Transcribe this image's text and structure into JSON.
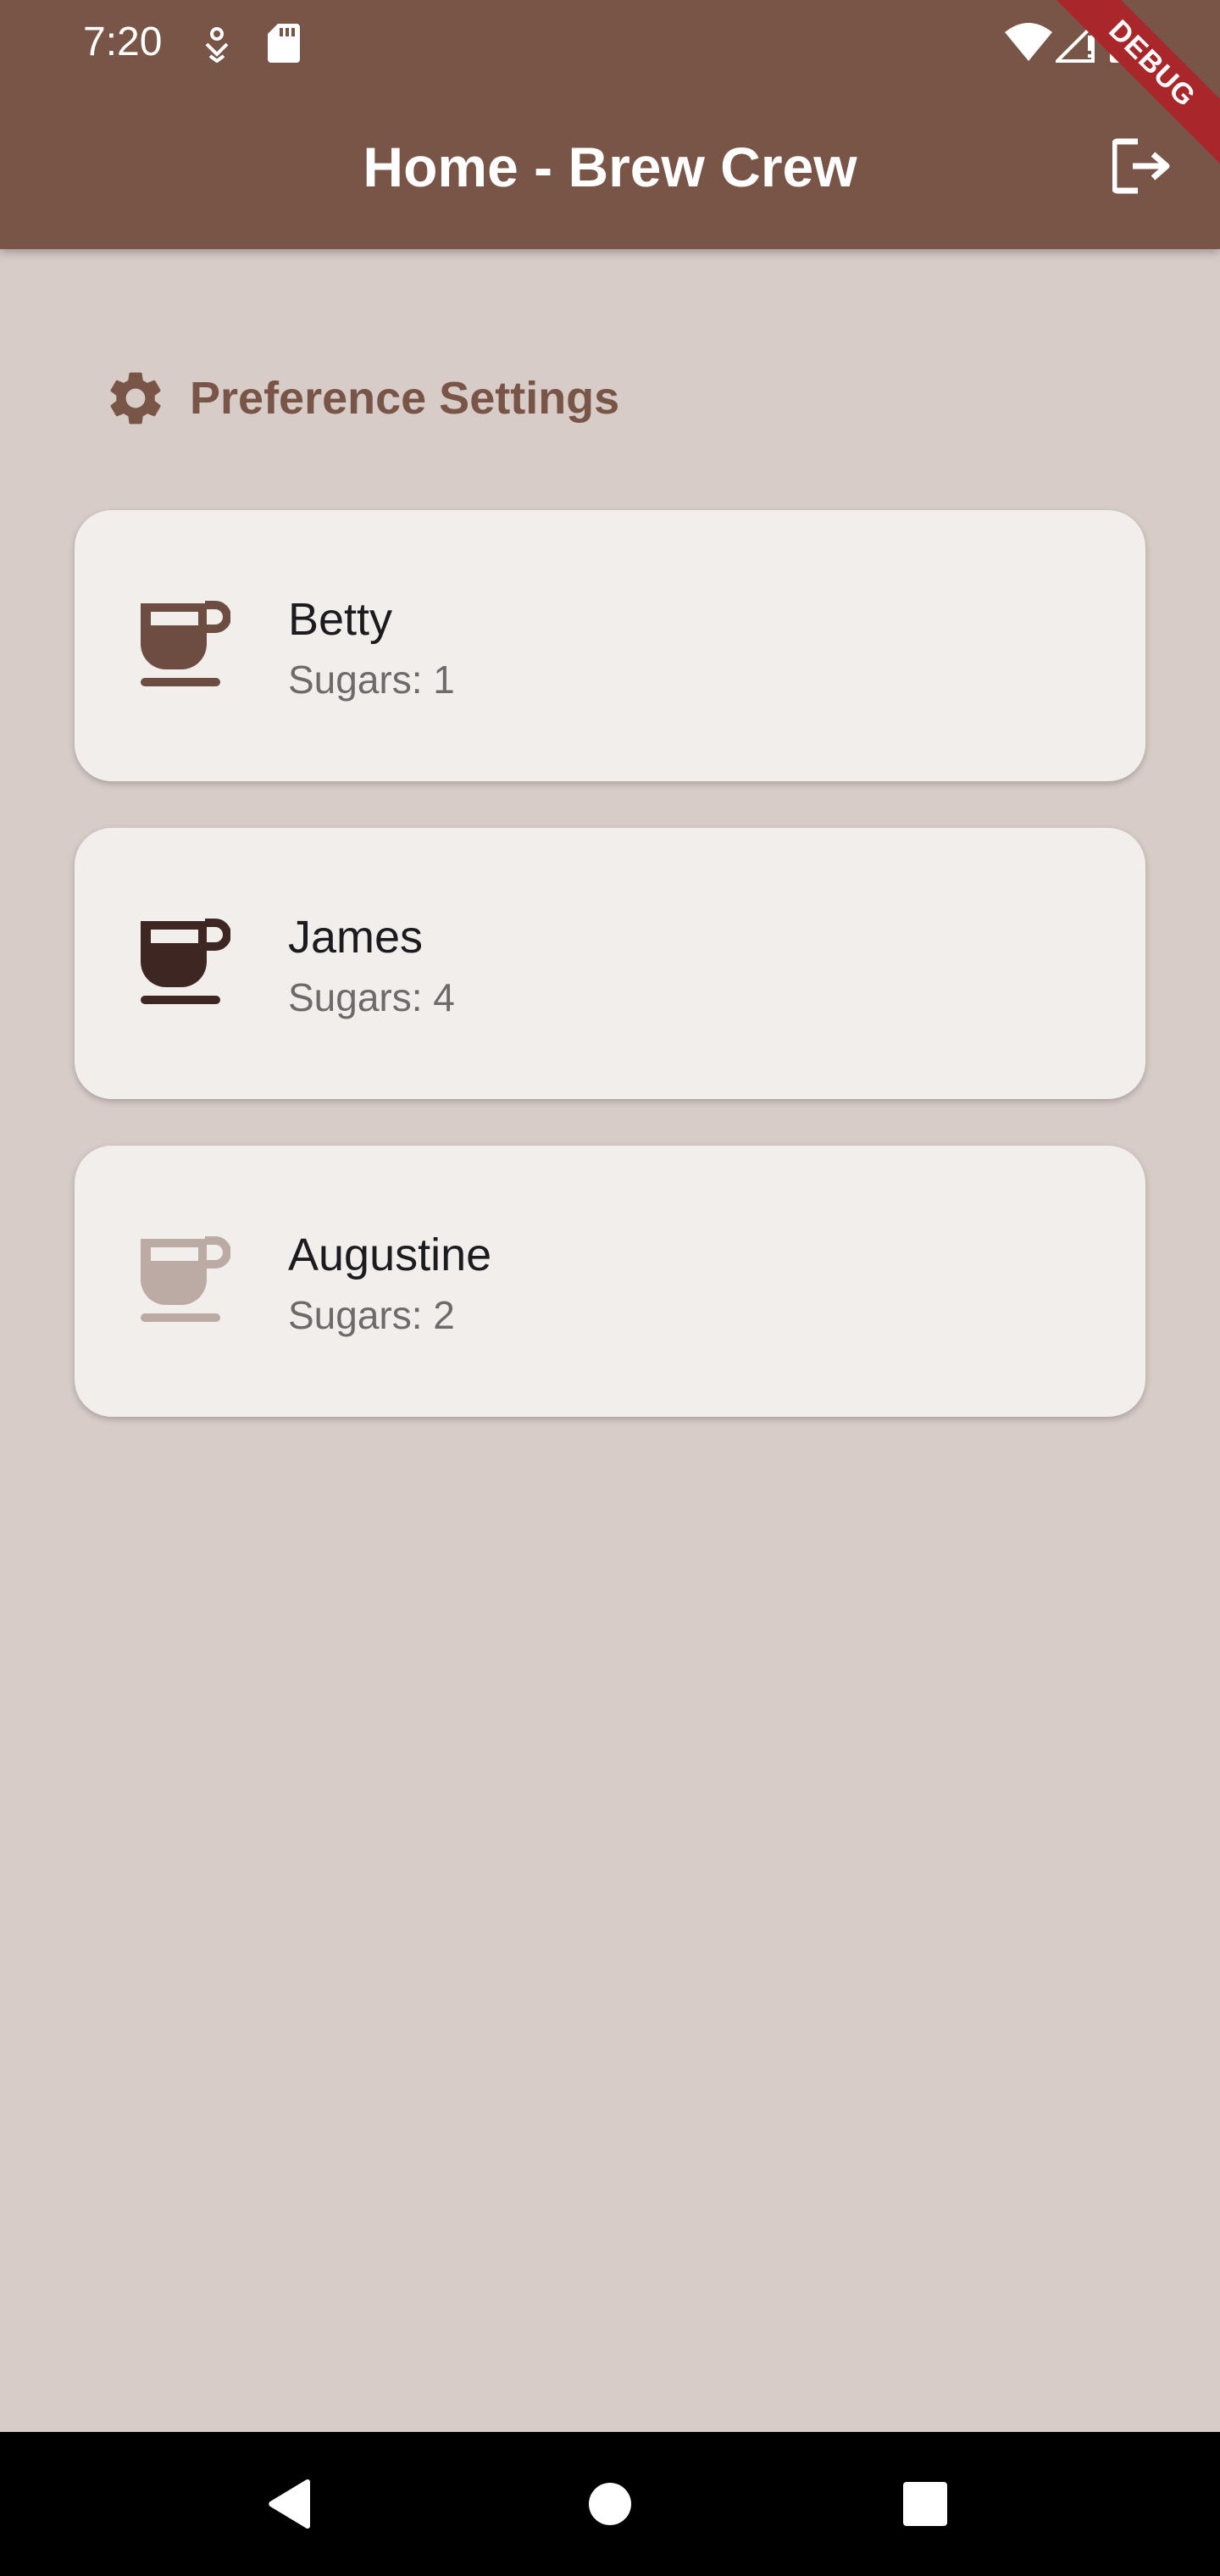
{
  "status_bar": {
    "time": "7:20"
  },
  "app_bar": {
    "title": "Home - Brew Crew",
    "logout_icon": "logout-icon",
    "debug_label": "DEBUG",
    "color": "#795548"
  },
  "preferences": {
    "label": "Preference Settings",
    "icon": "gear-icon"
  },
  "brews": [
    {
      "name": "Betty",
      "sugars": "Sugars: 1",
      "cup_color": "#6d4c41"
    },
    {
      "name": "James",
      "sugars": "Sugars: 4",
      "cup_color": "#3e2723"
    },
    {
      "name": "Augustine",
      "sugars": "Sugars: 2",
      "cup_color": "#bcaaa4"
    }
  ],
  "colors": {
    "background": "#d7ccc8",
    "card": "#f2eeec",
    "accent": "#795548",
    "debug_banner": "#a9272a"
  }
}
